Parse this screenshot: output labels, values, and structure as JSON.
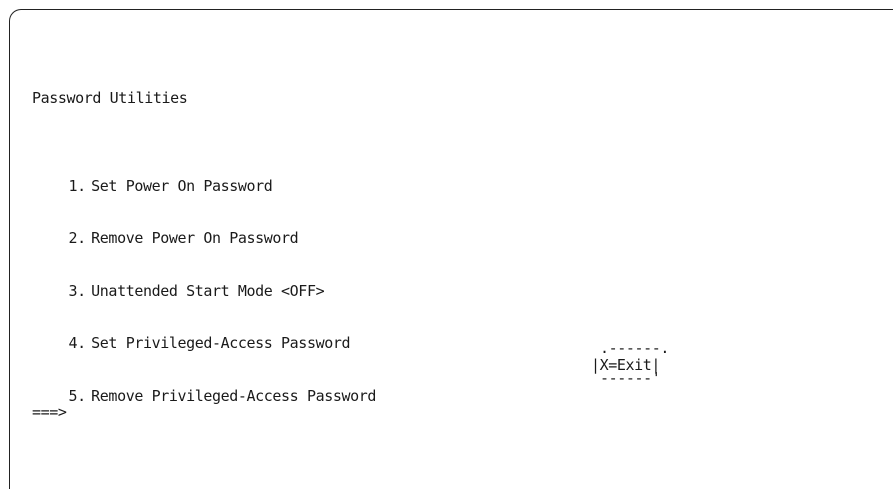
{
  "screen": {
    "title": "Password Utilities",
    "prompt": "===>"
  },
  "menu": {
    "items": [
      {
        "number": "1.",
        "label": "Set Power On Password"
      },
      {
        "number": "2.",
        "label": "Remove Power On Password"
      },
      {
        "number": "3.",
        "label": "Unattended Start Mode <OFF>"
      },
      {
        "number": "4.",
        "label": "Set Privileged-Access Password"
      },
      {
        "number": "5.",
        "label": "Remove Privileged-Access Password"
      }
    ]
  },
  "exit": {
    "top_border": ".------.",
    "label": "|X=Exit|",
    "bottom_border": "------'"
  }
}
